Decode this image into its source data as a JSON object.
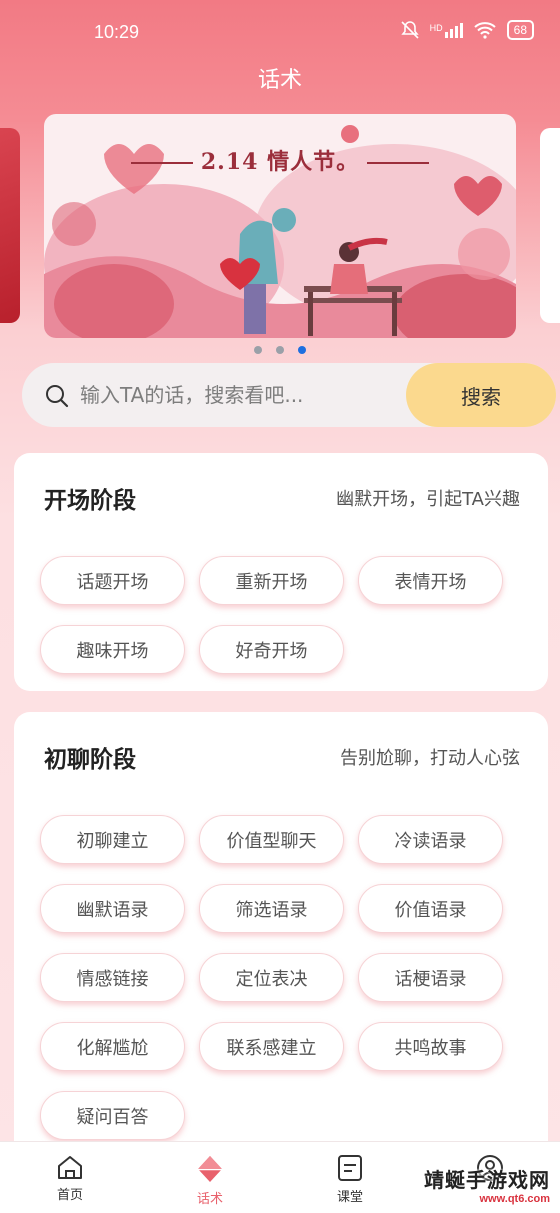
{
  "status_bar": {
    "time": "10:29",
    "battery": "68",
    "signal_label": "HD"
  },
  "header": {
    "title": "话术"
  },
  "banner": {
    "title": "2.14 情人节。",
    "slide_count": 3,
    "active_slide": 2
  },
  "search": {
    "placeholder": "输入TA的话，搜索看吧...",
    "button_label": "搜索"
  },
  "sections": [
    {
      "title": "开场阶段",
      "subtitle": "幽默开场，引起TA兴趣",
      "tags": [
        "话题开场",
        "重新开场",
        "表情开场",
        "趣味开场",
        "好奇开场"
      ]
    },
    {
      "title": "初聊阶段",
      "subtitle": "告别尬聊，打动人心弦",
      "tags": [
        "初聊建立",
        "价值型聊天",
        "冷读语录",
        "幽默语录",
        "筛选语录",
        "价值语录",
        "情感链接",
        "定位表决",
        "话梗语录",
        "化解尴尬",
        "联系感建立",
        "共鸣故事",
        "疑问百答"
      ]
    }
  ],
  "tabbar": {
    "items": [
      {
        "label": "首页",
        "icon": "home-icon"
      },
      {
        "label": "话术",
        "icon": "script-icon",
        "active": true
      },
      {
        "label": "课堂",
        "icon": "classroom-icon"
      },
      {
        "label": "",
        "icon": "profile-icon"
      }
    ]
  },
  "watermark": {
    "text": "靖蜒手游戏网",
    "url": "www.qt6.com"
  },
  "colors": {
    "accent": "#e8616c",
    "search_button": "#fbd98e",
    "header": "#f27a84"
  }
}
